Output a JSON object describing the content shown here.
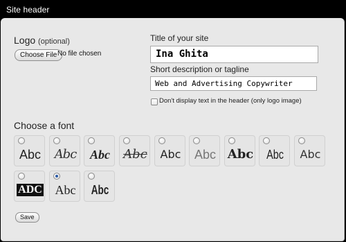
{
  "window": {
    "title": "Site header"
  },
  "logo": {
    "heading": "Logo",
    "optional": "(optional)",
    "choose_file_label": "Choose File",
    "file_status": "No file chosen"
  },
  "site_title": {
    "label": "Title of your site",
    "value": "Ina Ghita"
  },
  "tagline": {
    "label": "Short description or tagline",
    "value": "Web and Advertising Copywriter"
  },
  "logo_only_checkbox": {
    "label": "Don't display text in the header (only logo image)",
    "checked": false
  },
  "font_picker": {
    "heading": "Choose a font",
    "options": [
      {
        "sample": "Abc",
        "selected": false
      },
      {
        "sample": "Abc",
        "selected": false
      },
      {
        "sample": "Abc",
        "selected": false
      },
      {
        "sample": "Abc",
        "selected": false
      },
      {
        "sample": "Abc",
        "selected": false
      },
      {
        "sample": "Abc",
        "selected": false
      },
      {
        "sample": "Abc",
        "selected": false
      },
      {
        "sample": "Abc",
        "selected": false
      },
      {
        "sample": "Abc",
        "selected": false
      },
      {
        "sample": "ADC",
        "selected": false
      },
      {
        "sample": "Abc",
        "selected": true
      },
      {
        "sample": "Abc",
        "selected": false
      }
    ]
  },
  "save_label": "Save",
  "colors": {
    "titlebar": "#000000",
    "panel": "#e8e8e8",
    "radio_selected": "#2b5aa6"
  }
}
